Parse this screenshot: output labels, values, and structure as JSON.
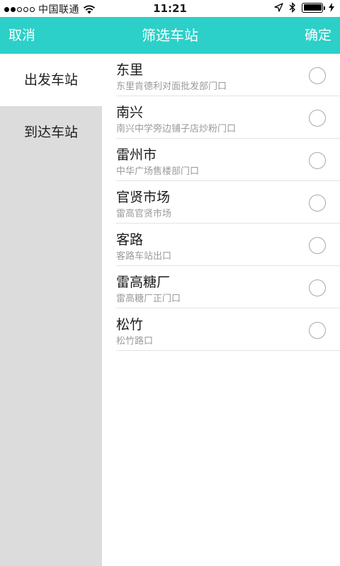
{
  "status_bar": {
    "carrier": "中国联通",
    "time": "11:21"
  },
  "nav": {
    "cancel": "取消",
    "title": "筛选车站",
    "confirm": "确定"
  },
  "sidebar": {
    "items": [
      {
        "label": "出发车站",
        "active": true
      },
      {
        "label": "到达车站",
        "active": false
      }
    ]
  },
  "stations": [
    {
      "name": "东里",
      "desc": "东里肯德利对面批发部门口"
    },
    {
      "name": "南兴",
      "desc": "南兴中学旁边铺子店炒粉门口"
    },
    {
      "name": "雷州市",
      "desc": "中华广场售楼部门口"
    },
    {
      "name": "官贤市场",
      "desc": "雷高官贤市场"
    },
    {
      "name": "客路",
      "desc": "客路车站出口"
    },
    {
      "name": "雷高糖厂",
      "desc": "雷高糖厂正门口"
    },
    {
      "name": "松竹",
      "desc": "松竹路口"
    }
  ],
  "colors": {
    "accent": "#2cd0c8",
    "sidebar_bg": "#dcdcdc"
  }
}
